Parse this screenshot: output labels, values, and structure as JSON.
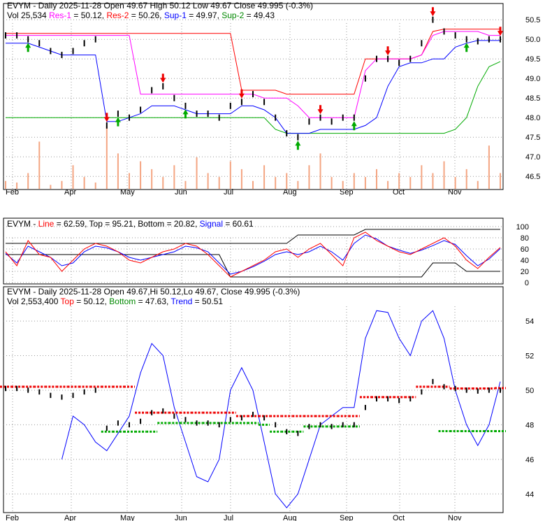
{
  "chart_data": [
    {
      "type": "line",
      "title": "EVYM - Daily 2025-11-28 Open 49.67  High 50.12  Low 49.67  Close 49.995 (-0.3%)",
      "ticker": "EVYM",
      "date": "2025-11-28",
      "header": {
        "p1": "EVYM - Daily 2025-11-28 Open 49.67  High 50.12  Low 49.67  Close 49.995 (-0.3%)",
        "vol": "Vol 25,534 ",
        "res1": "Res-1",
        "res1v": " = 50.12, ",
        "res2": "Res-2",
        "res2v": " = 50.26, ",
        "sup1": "Sup-1",
        "sup1v": " = 49.97, ",
        "sup2": "Sup-2",
        "sup2v": " = 49.43"
      },
      "ylim": [
        46.2,
        50.7
      ],
      "yticks": [
        "50.5",
        "50.0",
        "49.5",
        "49.0",
        "48.5",
        "48.0",
        "47.5",
        "47.0",
        "46.5"
      ],
      "ytick_values": [
        50.5,
        50.0,
        49.5,
        49.0,
        48.5,
        48.0,
        47.5,
        47.0,
        46.5
      ],
      "xticks": [
        "Feb",
        "Apr",
        "May",
        "Jun",
        "Jul",
        "Aug",
        "Sep",
        "Oct",
        "Nov"
      ],
      "close": [
        50.1,
        50.1,
        50.0,
        49.9,
        49.7,
        49.6,
        49.7,
        49.9,
        50.0,
        47.8,
        48.1,
        48.0,
        48.2,
        48.7,
        48.8,
        48.5,
        48.3,
        48.1,
        48.1,
        48.0,
        48.3,
        48.4,
        48.6,
        48.4,
        48.0,
        47.6,
        47.5,
        47.9,
        48.0,
        47.9,
        48.0,
        48.0,
        49.0,
        49.5,
        49.5,
        49.4,
        49.5,
        49.9,
        50.5,
        50.2,
        50.1,
        50.0,
        49.95,
        50.0,
        50.0
      ],
      "res1": [
        50.1,
        50.1,
        50.1,
        50.1,
        50.1,
        50.1,
        50.1,
        50.1,
        50.1,
        50.1,
        50.1,
        50.1,
        48.6,
        48.6,
        48.6,
        48.6,
        48.6,
        48.6,
        48.6,
        48.6,
        48.6,
        48.6,
        48.6,
        48.5,
        48.5,
        48.5,
        48.3,
        48.0,
        48.0,
        48.0,
        48.0,
        48.0,
        49.2,
        49.5,
        49.5,
        49.5,
        49.5,
        49.6,
        50.1,
        50.2,
        50.2,
        50.2,
        50.2,
        50.1,
        50.1
      ],
      "res2": [
        50.15,
        50.15,
        50.15,
        50.15,
        50.15,
        50.15,
        50.15,
        50.15,
        50.15,
        50.15,
        50.15,
        50.15,
        50.15,
        50.15,
        50.15,
        50.15,
        50.15,
        50.15,
        50.15,
        50.15,
        50.15,
        48.7,
        48.7,
        48.7,
        48.7,
        48.6,
        48.6,
        48.6,
        48.6,
        48.6,
        48.6,
        48.6,
        49.5,
        49.5,
        49.5,
        49.5,
        49.5,
        49.6,
        50.2,
        50.26,
        50.26,
        50.26,
        50.26,
        50.26,
        50.26
      ],
      "sup1": [
        49.9,
        49.9,
        49.9,
        49.8,
        49.7,
        49.6,
        49.6,
        49.6,
        49.6,
        47.9,
        47.9,
        48.0,
        48.1,
        48.3,
        48.3,
        48.3,
        48.2,
        48.1,
        48.1,
        48.1,
        48.1,
        48.3,
        48.3,
        48.2,
        48.0,
        47.6,
        47.6,
        47.6,
        47.7,
        47.7,
        47.7,
        47.7,
        47.8,
        48.0,
        48.8,
        49.3,
        49.4,
        49.4,
        49.5,
        49.5,
        49.8,
        49.9,
        49.97,
        49.97,
        49.97
      ],
      "sup2": [
        48.0,
        48.0,
        48.0,
        48.0,
        48.0,
        48.0,
        48.0,
        48.0,
        48.0,
        48.0,
        48.0,
        48.0,
        48.0,
        48.0,
        48.0,
        48.0,
        48.0,
        48.0,
        48.0,
        48.0,
        48.0,
        48.0,
        48.0,
        48.0,
        47.7,
        47.6,
        47.6,
        47.6,
        47.6,
        47.6,
        47.6,
        47.6,
        47.6,
        47.6,
        47.6,
        47.6,
        47.6,
        47.6,
        47.6,
        47.6,
        47.7,
        48.0,
        48.8,
        49.3,
        49.43
      ],
      "volume": [
        10,
        8,
        20,
        60,
        5,
        10,
        30,
        15,
        8,
        80,
        45,
        20,
        35,
        25,
        15,
        30,
        10,
        40,
        20,
        15,
        35,
        25,
        10,
        30,
        15,
        20,
        10,
        30,
        45,
        15,
        10,
        20,
        15,
        25,
        10,
        20,
        15,
        30,
        20,
        35,
        15,
        25,
        10,
        55,
        20
      ],
      "signals": [
        {
          "i": 2,
          "t": "up"
        },
        {
          "i": 9,
          "t": "down"
        },
        {
          "i": 10,
          "t": "up"
        },
        {
          "i": 14,
          "t": "down"
        },
        {
          "i": 16,
          "t": "up"
        },
        {
          "i": 21,
          "t": "down"
        },
        {
          "i": 26,
          "t": "up"
        },
        {
          "i": 28,
          "t": "down"
        },
        {
          "i": 31,
          "t": "up"
        },
        {
          "i": 34,
          "t": "down"
        },
        {
          "i": 38,
          "t": "down"
        },
        {
          "i": 41,
          "t": "up"
        },
        {
          "i": 44,
          "t": "down"
        }
      ]
    },
    {
      "type": "line",
      "title": "EVYM - Line = 62.59, Top = 95.21, Bottom = 20.82, Signal = 60.61",
      "header": {
        "a": "EVYM - ",
        "line": "Line",
        "b": " = 62.59, Top = 95.21, Bottom = 20.82, ",
        "signal": "Signal",
        "c": " = 60.61"
      },
      "ylim": [
        0,
        100
      ],
      "yticks": [
        "100",
        "80",
        "60",
        "40",
        "20",
        "0"
      ],
      "ytick_values": [
        100,
        80,
        60,
        40,
        20,
        0
      ],
      "line": [
        55,
        30,
        75,
        50,
        45,
        20,
        40,
        60,
        70,
        65,
        55,
        40,
        35,
        45,
        55,
        60,
        70,
        65,
        50,
        30,
        10,
        20,
        30,
        40,
        55,
        60,
        45,
        60,
        70,
        50,
        30,
        80,
        90,
        75,
        65,
        55,
        50,
        60,
        70,
        80,
        65,
        40,
        25,
        45,
        62.59
      ],
      "signal": [
        52,
        35,
        65,
        55,
        45,
        30,
        35,
        55,
        65,
        62,
        55,
        45,
        40,
        45,
        50,
        55,
        65,
        62,
        55,
        35,
        15,
        20,
        28,
        38,
        50,
        55,
        50,
        55,
        65,
        55,
        40,
        70,
        85,
        78,
        65,
        58,
        52,
        58,
        66,
        75,
        68,
        48,
        30,
        42,
        60.61
      ],
      "top": [
        70,
        70,
        70,
        70,
        70,
        70,
        70,
        70,
        70,
        70,
        70,
        70,
        70,
        70,
        70,
        70,
        70,
        70,
        70,
        70,
        70,
        70,
        70,
        70,
        70,
        70,
        85,
        85,
        85,
        85,
        85,
        85,
        95,
        95,
        95,
        95,
        95,
        95,
        95,
        95,
        95,
        95,
        95,
        95,
        95
      ],
      "bottom": [
        50,
        50,
        50,
        50,
        50,
        50,
        50,
        50,
        50,
        50,
        50,
        50,
        50,
        50,
        50,
        50,
        50,
        50,
        50,
        50,
        10,
        10,
        10,
        10,
        10,
        10,
        10,
        10,
        10,
        10,
        10,
        10,
        10,
        10,
        10,
        10,
        10,
        10,
        35,
        35,
        35,
        20,
        20,
        20,
        20
      ]
    },
    {
      "type": "line",
      "title": "EVYM - Daily 2025-11-28 Open 49.67,Hi 50.12,Lo 49.67, Close 49.995 (-0.3%)",
      "header": {
        "p1": "EVYM - Daily 2025-11-28 Open 49.67,Hi 50.12,Lo 49.67, Close 49.995 (-0.3%)",
        "vol": "Vol 2,553,400 ",
        "top": "Top",
        "topv": " = 50.12, ",
        "bottom": "Bottom",
        "bottomv": " = 47.63, ",
        "trend": "Trend",
        "trendv": " = 50.51"
      },
      "ylim": [
        43,
        55.5
      ],
      "yticks": [
        "54",
        "52",
        "50",
        "48",
        "46",
        "44"
      ],
      "ytick_values": [
        54,
        52,
        50,
        48,
        46,
        44
      ],
      "xticks": [
        "Feb",
        "Apr",
        "May",
        "Jun",
        "Jul",
        "Aug",
        "Sep",
        "Oct",
        "Nov"
      ],
      "trend": [
        null,
        null,
        null,
        null,
        null,
        46,
        48.5,
        48,
        47,
        46.5,
        47.5,
        48.5,
        51,
        52.7,
        52,
        49,
        47,
        45,
        44.7,
        46,
        50,
        51.3,
        50,
        47,
        44,
        43.2,
        44,
        46,
        48,
        48.5,
        49,
        49,
        53,
        54.6,
        54.5,
        53,
        52,
        54,
        54.6,
        53,
        50,
        48,
        46.8,
        48,
        50.5
      ],
      "top_line": [
        50.2,
        50.2,
        50.2,
        50.2,
        50.2,
        50.2,
        50.2,
        50.2,
        50.2,
        50.2,
        50.2,
        50.2,
        48.7,
        48.7,
        48.7,
        48.7,
        48.7,
        48.7,
        48.7,
        48.7,
        48.7,
        48.5,
        48.5,
        48.5,
        48.5,
        48.5,
        48.5,
        48.5,
        48.5,
        48.5,
        48.5,
        48.5,
        49.6,
        49.6,
        49.6,
        49.6,
        49.6,
        50.2,
        50.2,
        50.2,
        50.1,
        50.1,
        50.1,
        50.1,
        50.12
      ],
      "bottom_line": [
        null,
        null,
        null,
        null,
        null,
        null,
        null,
        null,
        null,
        47.6,
        47.6,
        47.6,
        47.6,
        47.6,
        48.1,
        48.1,
        48.1,
        48.1,
        48.1,
        48.1,
        48.1,
        48.1,
        48.1,
        48.0,
        47.6,
        47.6,
        47.6,
        47.9,
        47.9,
        47.9,
        47.9,
        47.9,
        null,
        null,
        null,
        null,
        null,
        null,
        null,
        47.63,
        47.63,
        47.63,
        47.63,
        47.63,
        47.63
      ]
    }
  ]
}
